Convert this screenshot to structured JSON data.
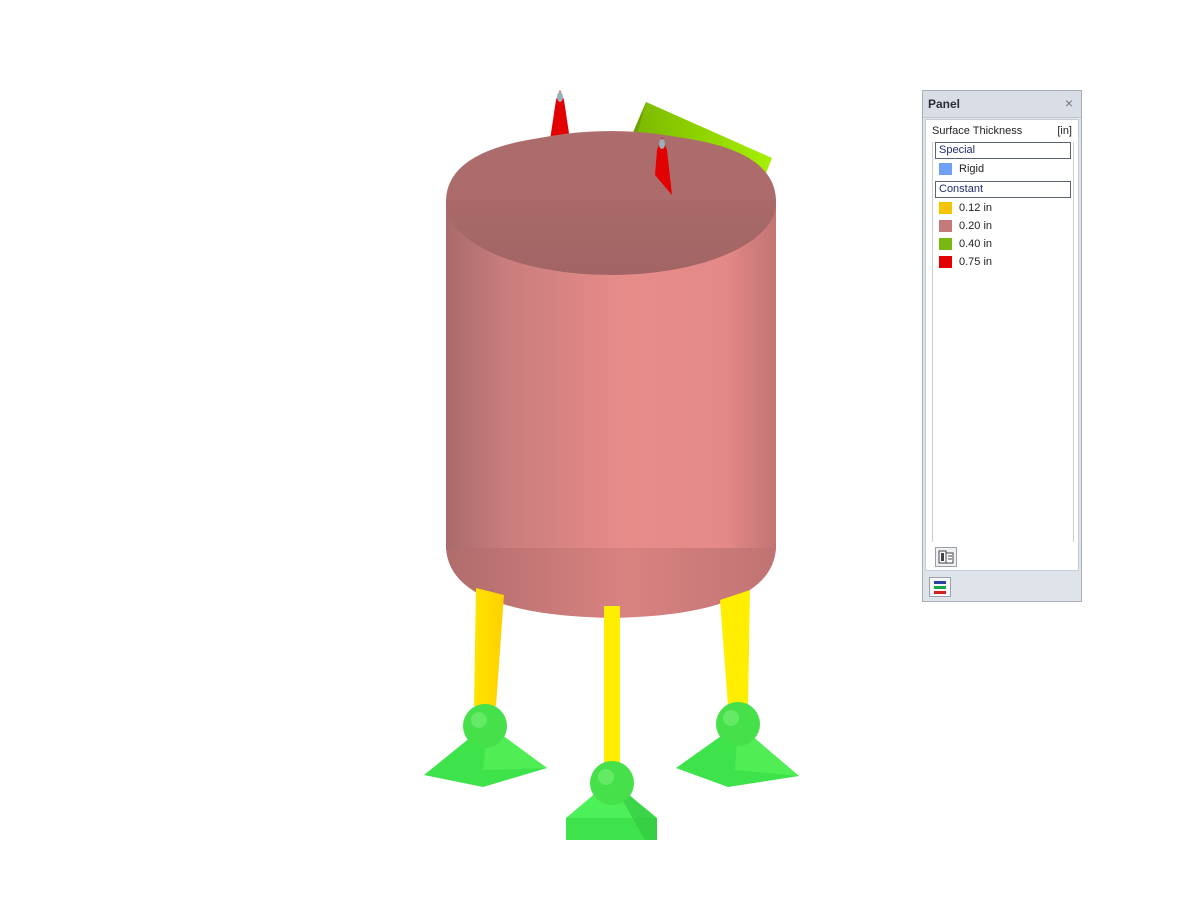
{
  "panel": {
    "title": "Panel",
    "close_glyph": "×",
    "header": {
      "label": "Surface Thickness",
      "unit": "[in]"
    },
    "groups": [
      {
        "title": "Special",
        "items": [
          {
            "label": "Rigid",
            "color": "#6ea0f5"
          }
        ]
      },
      {
        "title": "Constant",
        "items": [
          {
            "label": "0.12 in",
            "color": "#f3c400"
          },
          {
            "label": "0.20 in",
            "color": "#c4797a"
          },
          {
            "label": "0.40 in",
            "color": "#78b810"
          },
          {
            "label": "0.75 in",
            "color": "#e30000"
          }
        ]
      }
    ],
    "icons": {
      "tool": "settings-panel-icon",
      "footer": "color-legend-icon"
    }
  },
  "model": {
    "description_colors": {
      "shell": "#e58a88",
      "top_plate": "#8fe000",
      "lugs": "#e30000",
      "legs": "#ffe800",
      "supports": "#3ee24a"
    }
  }
}
